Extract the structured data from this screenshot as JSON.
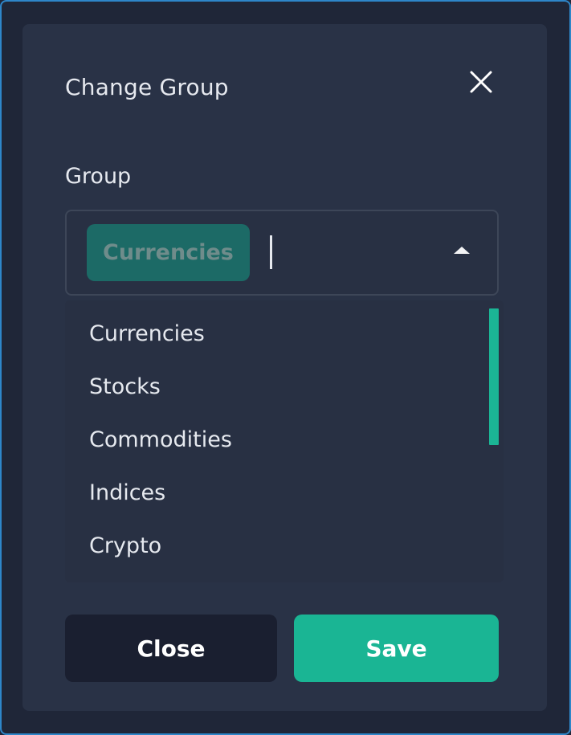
{
  "dialog": {
    "title": "Change Group",
    "close_icon": "close-icon"
  },
  "group_field": {
    "label": "Group",
    "selected_chip": "Currencies",
    "input_value": "",
    "expanded": true
  },
  "dropdown": {
    "options": [
      "Currencies",
      "Stocks",
      "Commodities",
      "Indices",
      "Crypto"
    ]
  },
  "buttons": {
    "close_label": "Close",
    "save_label": "Save"
  },
  "colors": {
    "accent": "#1ab594",
    "modal_bg": "#293246",
    "page_bg": "#1f2638",
    "chip_bg": "#1c6a66",
    "close_button_bg": "#1a1f30"
  }
}
